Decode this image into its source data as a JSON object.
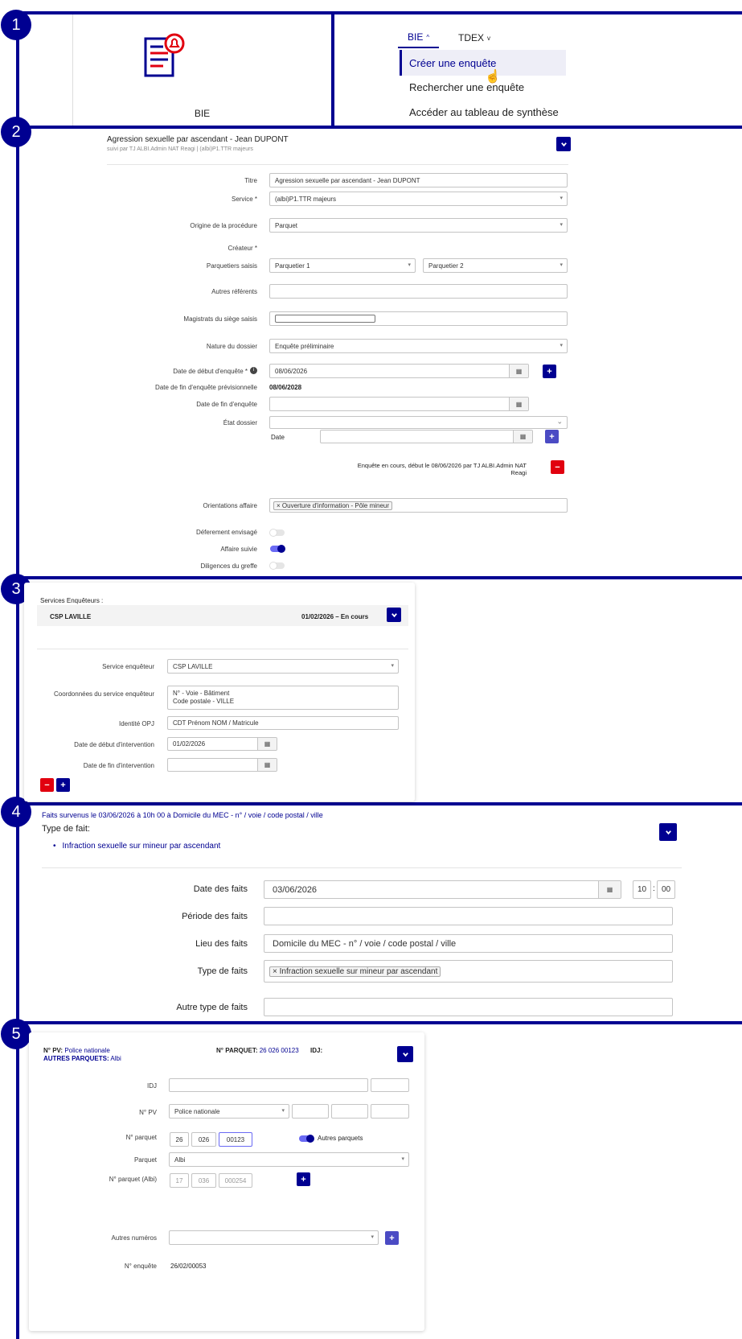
{
  "steps": [
    "1",
    "2",
    "3",
    "4",
    "5"
  ],
  "s1": {
    "bie_label": "BIE",
    "menu": {
      "tab_bie": "BIE",
      "tab_tdex": "TDEX",
      "items": [
        "Créer une enquête",
        "Rechercher une enquête",
        "Accéder au tableau de synthèse"
      ]
    }
  },
  "s2": {
    "title": "Agression sexuelle par ascendant - Jean DUPONT",
    "subtitle": "suivi par TJ ALBI.Admin NAT Reagi | (albi)P1.TTR majeurs",
    "labels": {
      "titre": "Titre",
      "service": "Service *",
      "origine": "Origine de la procédure",
      "createur": "Créateur *",
      "parquetiers": "Parquetiers saisis",
      "autres_ref": "Autres référents",
      "magistrats": "Magistrats du siège saisis",
      "nature": "Nature du dossier",
      "date_debut": "Date de début d'enquête *",
      "date_fin_prev": "Date de fin d'enquête prévisionnelle",
      "date_fin": "Date de fin d'enquête",
      "etat": "État dossier",
      "date": "Date",
      "orientations": "Orientations affaire",
      "deferement": "Déferement envisagé",
      "affaire_suivie": "Affaire suivie",
      "diligences": "Diligences du greffe"
    },
    "values": {
      "titre": "Agression sexuelle par ascendant - Jean DUPONT",
      "service": "(albi)P1.TTR majeurs",
      "origine": "Parquet",
      "parquetier1": "Parquetier 1",
      "parquetier2": "Parquetier 2",
      "nature": "Enquête préliminaire",
      "date_debut": "08/06/2026",
      "date_fin_prev": "08/06/2028",
      "status_text": "Enquête en cours, début le 08/06/2026 par TJ ALBI.Admin NAT Reagi",
      "orientation_tag": "Ouverture d'information - Pôle mineur"
    },
    "toggles": {
      "deferement": false,
      "affaire_suivie": true,
      "diligences": false
    }
  },
  "s3": {
    "header": "Services Enquêteurs :",
    "row_name": "CSP LAVILLE",
    "row_status": "01/02/2026 – En cours",
    "labels": {
      "service": "Service enquêteur",
      "coord": "Coordonnées du service enquêteur",
      "opj": "Identité OPJ",
      "debut": "Date de début d'intervention",
      "fin": "Date de fin d'intervention"
    },
    "values": {
      "service": "CSP LAVILLE",
      "coord_line1": "N° - Voie - Bâtiment",
      "coord_line2": "Code postale - VILLE",
      "opj": "CDT Prénom NOM / Matricule",
      "debut": "01/02/2026"
    }
  },
  "s4": {
    "heading": "Faits survenus le 03/06/2026 à 10h 00 à Domicile du MEC - n° / voie / code postal / ville",
    "type_label": "Type de fait:",
    "type_item": "Infraction sexuelle sur mineur par ascendant",
    "labels": {
      "date": "Date des faits",
      "periode": "Période des faits",
      "lieu": "Lieu des faits",
      "type": "Type de faits",
      "autre": "Autre type de faits"
    },
    "values": {
      "date": "03/06/2026",
      "hour": "10",
      "minute": "00",
      "lieu": "Domicile du MEC - n° / voie / code postal / ville",
      "type_tag": "Infraction sexuelle sur mineur par ascendant"
    }
  },
  "s5": {
    "pv_label": "N° PV:",
    "pv_value": "Police nationale",
    "autres_label": "AUTRES PARQUETS:",
    "autres_value": "Albi",
    "parquet_label": "N° PARQUET:",
    "parquet_value": "26 026 00123",
    "idj_header": "IDJ:",
    "labels": {
      "idj": "IDJ",
      "pv": "N° PV",
      "num_parquet": "N° parquet",
      "parquet": "Parquet",
      "num_parquet_albi": "N° parquet (Albi)",
      "autres_numeros": "Autres numéros",
      "num_enquete": "N° enquête",
      "autres_parquets": "Autres parquets"
    },
    "values": {
      "pv": "Police nationale",
      "np1": "26",
      "np2": "026",
      "np3": "00123",
      "parquet": "Albi",
      "albi1": "17",
      "albi2": "036",
      "albi3": "000254",
      "num_enquete": "26/02/00053"
    }
  },
  "colors": {
    "primary": "#000091",
    "red": "#e1000f",
    "accent": "#6a6af4"
  }
}
